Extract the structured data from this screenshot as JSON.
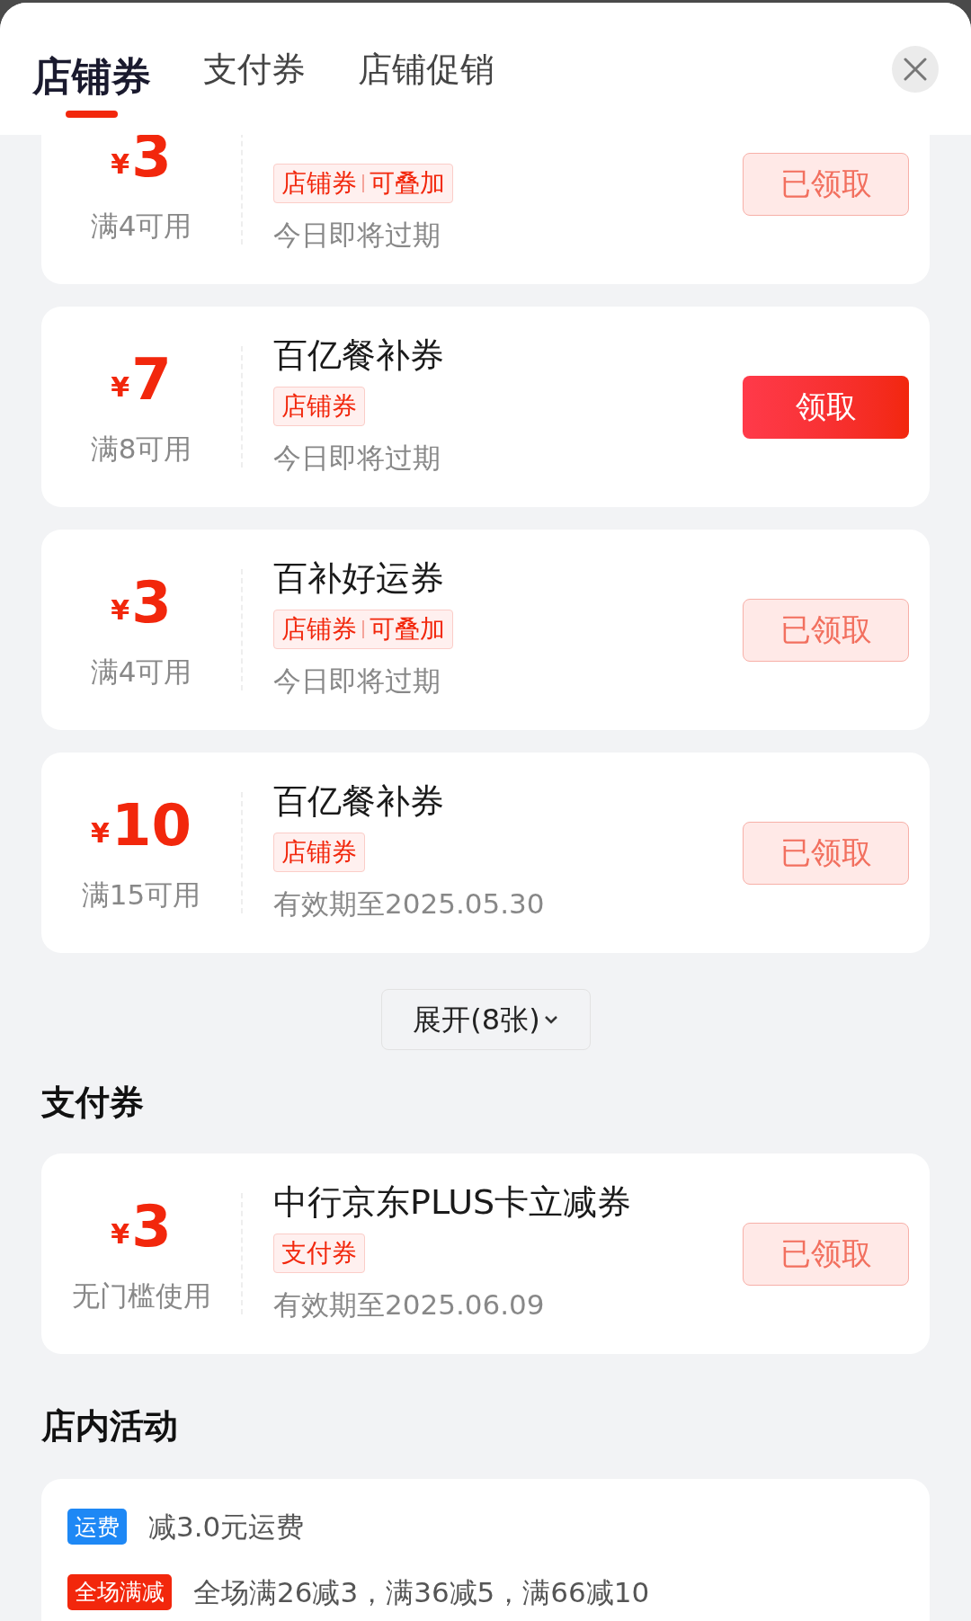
{
  "tabs": [
    {
      "label": "店铺券",
      "selected": true
    },
    {
      "label": "支付券",
      "selected": false
    },
    {
      "label": "店铺促销",
      "selected": false
    }
  ],
  "shop_coupons": [
    {
      "currency": "¥",
      "amount": "3",
      "condition": "满4可用",
      "tags": [
        "店铺券",
        "可叠加"
      ],
      "validity": "今日即将过期",
      "button": "已领取",
      "claimed": true
    },
    {
      "currency": "¥",
      "amount": "7",
      "condition": "满8可用",
      "title": "百亿餐补券",
      "tags": [
        "店铺券"
      ],
      "validity": "今日即将过期",
      "button": "领取",
      "claimed": false
    },
    {
      "currency": "¥",
      "amount": "3",
      "condition": "满4可用",
      "title": "百补好运券",
      "tags": [
        "店铺券",
        "可叠加"
      ],
      "validity": "今日即将过期",
      "button": "已领取",
      "claimed": true
    },
    {
      "currency": "¥",
      "amount": "10",
      "condition": "满15可用",
      "title": "百亿餐补券",
      "tags": [
        "店铺券"
      ],
      "validity": "有效期至2025.05.30",
      "button": "已领取",
      "claimed": true
    }
  ],
  "expand_button": "展开(8张)",
  "payment_section": {
    "heading": "支付券",
    "coupons": [
      {
        "currency": "¥",
        "amount": "3",
        "condition": "无门槛使用",
        "title": "中行京东PLUS卡立减券",
        "tags": [
          "支付券"
        ],
        "validity": "有效期至2025.06.09",
        "button": "已领取",
        "claimed": true
      }
    ]
  },
  "activities_section": {
    "heading": "店内活动",
    "items": [
      {
        "badge": "运费",
        "color": "#1e88f5",
        "text": "减3.0元运费"
      },
      {
        "badge": "全场满减",
        "color": "#f2270c",
        "text": "全场满26减3，满36减5，满66减10"
      }
    ]
  }
}
